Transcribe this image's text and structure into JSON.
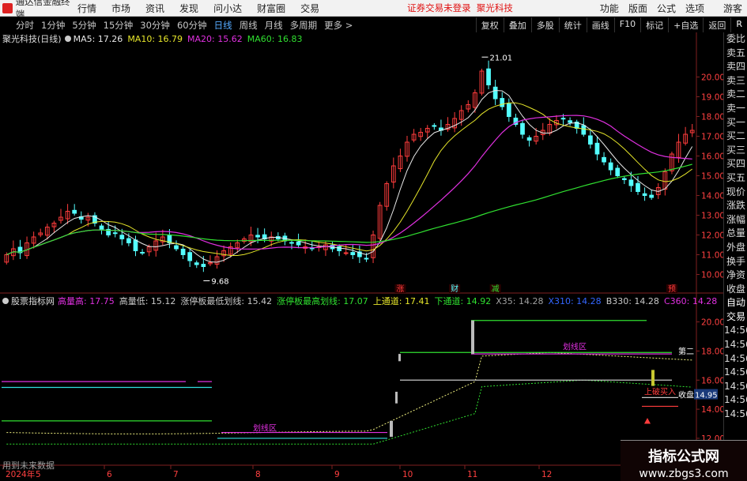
{
  "window": {
    "app_name": "通达信金融终端",
    "alert": "证券交易未登录",
    "stock_name": "聚光科技",
    "user": "游客"
  },
  "menu": [
    "行情",
    "市场",
    "资讯",
    "发现",
    "问小达",
    "财富圈",
    "交易"
  ],
  "right_menu": [
    "功能",
    "版面",
    "公式",
    "选项"
  ],
  "periods": [
    "分时",
    "1分钟",
    "5分钟",
    "15分钟",
    "30分钟",
    "60分钟",
    "日线",
    "周线",
    "月线",
    "多周期",
    "更多 >"
  ],
  "active_period": "日线",
  "right_buttons": [
    "复权",
    "叠加",
    "多股",
    "统计",
    "画线",
    "F10",
    "标记",
    "+自选",
    "返回"
  ],
  "main_legend": {
    "title": "聚光科技(日线)",
    "items": [
      {
        "label": "MA5: 17.26",
        "color": "#e8e8e8"
      },
      {
        "label": "MA10: 16.79",
        "color": "#e6e62a"
      },
      {
        "label": "MA20: 15.62",
        "color": "#e030e0"
      },
      {
        "label": "MA60: 16.83",
        "color": "#30e030"
      }
    ]
  },
  "sub_legend": {
    "title": "股票指标网",
    "items": [
      {
        "label": "高量高: 17.75",
        "color": "#e030e0"
      },
      {
        "label": "高量低: 15.12",
        "color": "#c8c8c8"
      },
      {
        "label": "涨停板最低划线: 15.42",
        "color": "#c8c8c8"
      },
      {
        "label": "涨停板最高划线: 17.07",
        "color": "#30e030"
      },
      {
        "label": "上通道: 17.41",
        "color": "#e6e62a"
      },
      {
        "label": "下通道: 14.92",
        "color": "#30e030"
      },
      {
        "label": "X35: 14.28",
        "color": "#a0a0a0"
      },
      {
        "label": "X310: 14.28",
        "color": "#3366ff"
      },
      {
        "label": "B330: 14.28",
        "color": "#c8c8c8"
      },
      {
        "label": "C360: 14.28",
        "color": "#e030e0"
      }
    ]
  },
  "order_book_labels": [
    "委比",
    "卖五",
    "卖四",
    "卖三",
    "卖二",
    "卖一",
    "买一",
    "买二",
    "买三",
    "买四",
    "买五",
    "现价",
    "涨跌",
    "涨幅",
    "总量",
    "外盘",
    "换手",
    "净资",
    "收盘",
    "自动",
    "交易",
    "14:56",
    "14:56",
    "14:56",
    "14:56",
    "14:56",
    "14:56",
    "14:56"
  ],
  "watermark": {
    "line1": "指标公式网",
    "line2": "www.zbgs3.com"
  },
  "footer_note": "用到未来数据",
  "colors": {
    "up": "#ff3c3c",
    "down": "#54ffff",
    "ma5": "#e8e8e8",
    "ma10": "#e6e62a",
    "ma20": "#e030e0",
    "ma60": "#30e030"
  },
  "chart_data": [
    {
      "type": "candlestick",
      "title": "聚光科技(日线)",
      "y_ticks": [
        "20.00",
        "19.00",
        "18.00",
        "17.00",
        "16.00",
        "15.00",
        "14.00",
        "13.00",
        "12.00",
        "11.00",
        "10.00"
      ],
      "ylim": [
        9.5,
        21.3
      ],
      "x_ticks": [
        "2024年",
        "5",
        "6",
        "7",
        "8",
        "9",
        "10",
        "11",
        "12"
      ],
      "closes": [
        11.0,
        11.3,
        11.1,
        11.6,
        11.9,
        12.1,
        12.4,
        12.6,
        12.9,
        13.2,
        13.1,
        12.8,
        12.9,
        12.6,
        12.3,
        12.0,
        12.1,
        11.8,
        11.6,
        11.2,
        11.1,
        11.4,
        11.7,
        11.9,
        11.6,
        11.3,
        11.0,
        10.7,
        10.5,
        10.4,
        10.6,
        10.9,
        11.2,
        11.4,
        11.6,
        11.8,
        12.0,
        11.9,
        11.8,
        11.9,
        11.8,
        11.7,
        11.6,
        11.5,
        11.4,
        11.3,
        11.4,
        11.5,
        11.3,
        11.2,
        11.1,
        11.0,
        10.9,
        10.8,
        12.0,
        13.5,
        14.6,
        15.5,
        16.0,
        16.7,
        17.1,
        17.2,
        17.4,
        17.5,
        17.3,
        17.6,
        17.9,
        18.3,
        18.6,
        19.2,
        20.3,
        19.6,
        18.9,
        18.5,
        18.0,
        17.6,
        17.1,
        16.8,
        17.0,
        17.3,
        17.6,
        17.8,
        17.9,
        17.7,
        17.4,
        17.1,
        16.6,
        16.1,
        15.7,
        15.3,
        15.0,
        14.8,
        14.5,
        14.2,
        14.0,
        13.9,
        14.4,
        15.2,
        16.1,
        16.7,
        17.1,
        17.3
      ],
      "markers": [
        {
          "text": "21.01",
          "index": 70,
          "value": 21.01
        },
        {
          "text": "9.68",
          "index": 29,
          "value": 9.68
        }
      ],
      "event_tags": [
        {
          "text": "涨",
          "index": 58,
          "color": "#ff3c3c"
        },
        {
          "text": "财",
          "index": 66,
          "color": "#54ffff"
        },
        {
          "text": "减",
          "index": 72,
          "color": "#30e030"
        },
        {
          "text": "预",
          "index": 98,
          "color": "#ff3c3c"
        }
      ]
    },
    {
      "type": "line",
      "title": "股票指标网",
      "y_ticks": [
        "20.00",
        "18.00",
        "16.00",
        "14.00",
        "12.00"
      ],
      "ylim": [
        11.4,
        20.9
      ],
      "labels": [
        {
          "text": "划线区",
          "color": "#e030e0"
        },
        {
          "text": "划线区",
          "color": "#e030e0"
        },
        {
          "text": "上破买入",
          "color": "#ff3c3c"
        },
        {
          "text": "收盘",
          "color": "#fff"
        },
        {
          "text": "14.95",
          "color": "#fff"
        },
        {
          "text": "第二",
          "color": "#fff"
        }
      ]
    }
  ]
}
